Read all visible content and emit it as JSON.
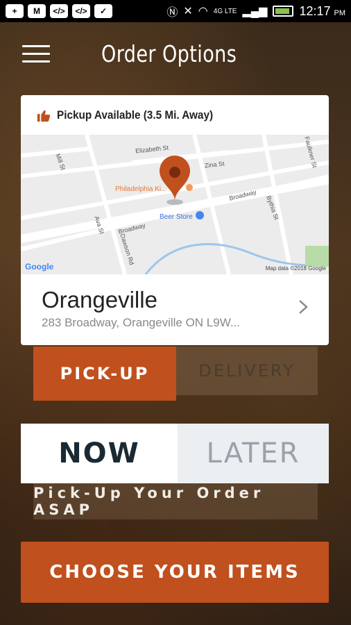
{
  "status_bar": {
    "icons": [
      "plus-icon",
      "mail-icon",
      "code-icon",
      "code-icon",
      "chat-icon",
      "nfc-icon",
      "mute-icon",
      "wifi-icon",
      "lte-icon",
      "signal-icon",
      "battery-icon"
    ],
    "network": "4G LTE",
    "time": "12:17",
    "ampm": "PM"
  },
  "header": {
    "title": "Order Options",
    "menu_icon": "hamburger-icon"
  },
  "location_card": {
    "pickup_text": "Pickup Available (3.5 Mi. Away)",
    "pickup_icon": "thumbs-up-icon",
    "map": {
      "streets": [
        "Elizabeth St",
        "Zina St",
        "Broadway",
        "Broadway",
        "Mill St",
        "Bythia St",
        "Faulkner St",
        "Ava St",
        "Dawson Rd"
      ],
      "places": [
        "Philadelphia Ki...",
        "Beer Store"
      ],
      "google": "Google",
      "credit": "Map data ©2018 Google"
    },
    "store_name": "Orangeville",
    "store_address": "283 Broadway, Orangeville ON L9W..."
  },
  "method": {
    "pickup": "PICK-UP",
    "delivery": "DELIVERY",
    "selected": "PICK-UP"
  },
  "timing": {
    "now": "NOW",
    "later": "LATER",
    "selected": "NOW",
    "note": "Pick-Up Your Order ASAP"
  },
  "cta": {
    "label": "CHOOSE YOUR ITEMS"
  },
  "colors": {
    "accent": "#c0501e",
    "dark_text": "#1a2a33"
  }
}
